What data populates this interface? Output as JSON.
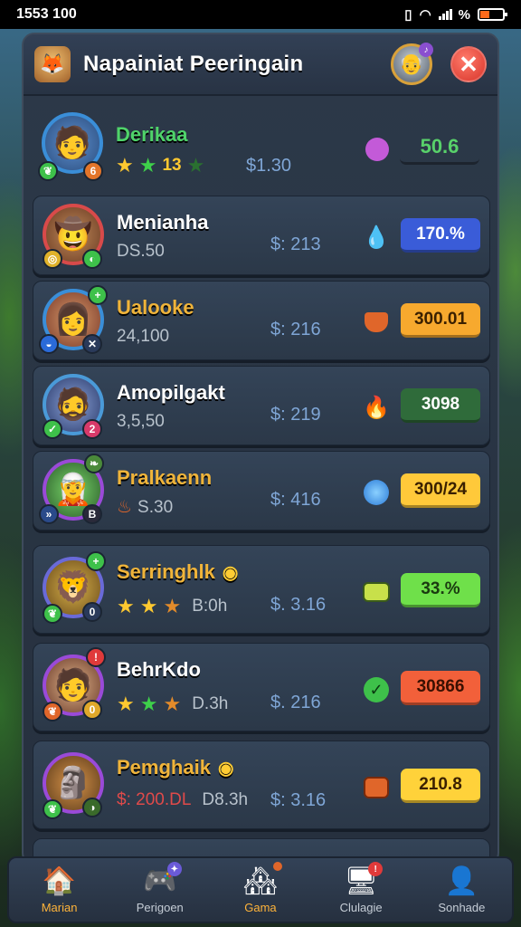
{
  "status": {
    "time": "1553 100",
    "battery": "%"
  },
  "header": {
    "title": "Napainiat Peeringain"
  },
  "rows": [
    {
      "name": "Derikaa",
      "name_color": "#4fd36a",
      "sub": "13",
      "price": "$1.30",
      "value": "50.6",
      "value_color": "#58d16a",
      "value_bg": "transparent",
      "avatar_emoji": "🧑",
      "item_icon": "🟣"
    },
    {
      "name": "Menianha",
      "name_color": "#ffffff",
      "sub": "DS.50",
      "price": "$: 213",
      "value": "170.%",
      "value_color": "#ffffff",
      "value_bg": "#3a5cd8",
      "avatar_emoji": "🤠",
      "item_icon": "💧"
    },
    {
      "name": "Ualooke",
      "name_color": "#f0b43a",
      "sub": "24,100",
      "price": "$: 216",
      "value": "300.01",
      "value_color": "#3a2000",
      "value_bg": "#f7a92e",
      "avatar_emoji": "👩",
      "item_icon": "🛡"
    },
    {
      "name": "Amopilgakt",
      "name_color": "#ffffff",
      "sub": "3,5,50",
      "price": "$: 219",
      "value": "3098",
      "value_color": "#ffffff",
      "value_bg": "#2f6b3a",
      "avatar_emoji": "🧔",
      "item_icon": "🔥"
    },
    {
      "name": "Pralkaenn",
      "name_color": "#f0b43a",
      "sub": "S.30",
      "price": "$: 416",
      "value": "300/24",
      "value_color": "#3a2000",
      "value_bg": "#ffc93a",
      "avatar_emoji": "🧝",
      "item_icon": "🔵"
    },
    {
      "name": "Serringhlk",
      "name_color": "#f0b43a",
      "sub": "B:0h",
      "price": "$. 3.16",
      "value": "33.%",
      "value_color": "#1a3a10",
      "value_bg": "#6fe04a",
      "avatar_emoji": "🦁",
      "item_icon": "🟩"
    },
    {
      "name": "BehrKdo",
      "name_color": "#ffffff",
      "name_color_2": "#4fd36a",
      "sub": "D.3h",
      "price": "$. 216",
      "value": "30866",
      "value_color": "#3a1000",
      "value_bg": "#f2603a",
      "avatar_emoji": "🧑",
      "item_icon": "✅"
    },
    {
      "name": "Pemghaik",
      "name_color": "#f0b43a",
      "sub": "D8.3h",
      "sub_prefix": "$: 200.DL",
      "price": "$: 3.16",
      "value": "210.8",
      "value_color": "#3a2000",
      "value_bg": "#ffd23a",
      "avatar_emoji": "🗿",
      "item_icon": "🟧"
    }
  ],
  "nav": [
    {
      "label": "Marian",
      "icon": "🏠",
      "active": true
    },
    {
      "label": "Perigoen",
      "icon": "🎮",
      "active": false
    },
    {
      "label": "Gama",
      "icon": "🏘",
      "active": true
    },
    {
      "label": "Clulagie",
      "icon": "🖥",
      "active": false
    },
    {
      "label": "Sonhade",
      "icon": "👤",
      "active": false
    }
  ],
  "colors": {
    "accent": "#ffb43a",
    "panel": "#2c3949",
    "close": "#d8342a"
  }
}
